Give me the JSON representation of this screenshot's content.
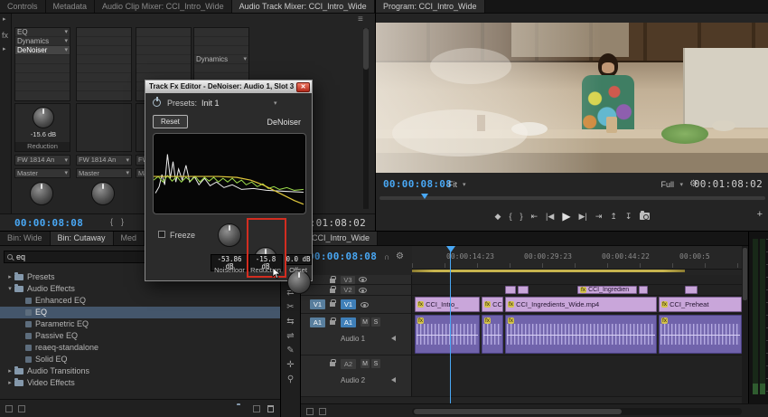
{
  "colors": {
    "timecode_blue": "#49a8f5",
    "video_clip": "#c9a6da",
    "audio_clip": "#7063ab",
    "fx_badge_yellow": "#d3c24a",
    "annotation_red": "#d22d20",
    "work_bar_yellow": "#b3a14c",
    "target_blue": "#3f7fb8"
  },
  "top_tabs": {
    "controls": "Controls",
    "metadata": "Metadata",
    "clip_mixer": "Audio Clip Mixer: CCI_Intro_Wide",
    "track_mixer": "Audio Track Mixer: CCI_Intro_Wide"
  },
  "program": {
    "tab": "Program: CCI_Intro_Wide",
    "timecode": "00:00:08:08",
    "fit": "Fit",
    "quality": "Full",
    "duration": "00:01:08:02"
  },
  "mixer": {
    "gutter_fx": "fx",
    "rack1_effects": [
      "EQ",
      "Dynamics",
      "DeNoiser"
    ],
    "rack4_effect": "Dynamics",
    "param_value": "-15.6 dB",
    "param_label": "Reduction",
    "io_device": "FW 1814 An",
    "output_bus": "Master",
    "timecode": "00:00:08:08",
    "duration": "00:01:08:02"
  },
  "fx_dialog": {
    "title": "Track Fx Editor - DeNoiser: Audio 1, Slot 3",
    "presets_label": "Presets:",
    "preset_value": "Init 1",
    "reset_button": "Reset",
    "effect_name": "DeNoiser",
    "freeze_label": "Freeze",
    "knobs": [
      {
        "value": "-53.86 dB",
        "label": "Noisefloor"
      },
      {
        "value": "-15.8 dB",
        "label": "Reduction"
      },
      {
        "value": "0.0 dB",
        "label": "Offset"
      }
    ]
  },
  "bins": {
    "tabs": [
      "Bin: Wide",
      "Bin: Cutaway",
      "Med"
    ],
    "search_value": "eq",
    "items": [
      "Presets",
      "Audio Effects",
      "Enhanced EQ",
      "EQ",
      "Parametric EQ",
      "Passive EQ",
      "reaeq-standalone",
      "Solid EQ",
      "Audio Transitions",
      "Video Effects"
    ]
  },
  "timeline": {
    "tab": "CCI_Intro_Wide",
    "timecode": "00:00:08:08",
    "ruler_labels": [
      "00:00:14:23",
      "00:00:29:23",
      "00:00:44:22",
      "00:00:5"
    ],
    "tracks": {
      "v3": "V3",
      "v2": "V2",
      "v1": "V1",
      "a1": "A1",
      "a2": "A2",
      "audio1": "Audio 1",
      "audio2": "Audio 2",
      "mute": "M",
      "solo": "S"
    },
    "fx_badge": "fx",
    "v2_clip_label": "CCI_Ingredien",
    "v1_clips": [
      "CCI_Intro_",
      "CCI_I",
      "CCI_Ingredients_Wide.mp4",
      "CCI_Preheat"
    ]
  },
  "icons": {
    "chevron_down": "▾",
    "chevron_right": "▸",
    "menu": "≡",
    "close": "✕",
    "add_marker": "◆",
    "mark_in": "{",
    "mark_out": "}",
    "go_to_in": "⇤",
    "step_back": "|◀",
    "play": "▶",
    "step_forward": "▶|",
    "go_to_out": "⇥",
    "lift": "↥",
    "extract": "↧",
    "plus": "+",
    "wrench": "⚙",
    "snap": "∩",
    "tool_selection": "↖",
    "tool_track_select": "⇥",
    "tool_ripple": "⇄",
    "tool_razor": "✂",
    "tool_slip": "⇆",
    "tool_slide": "⇌",
    "tool_pen": "✎",
    "tool_hand": "✛",
    "tool_zoom": "⚲"
  }
}
